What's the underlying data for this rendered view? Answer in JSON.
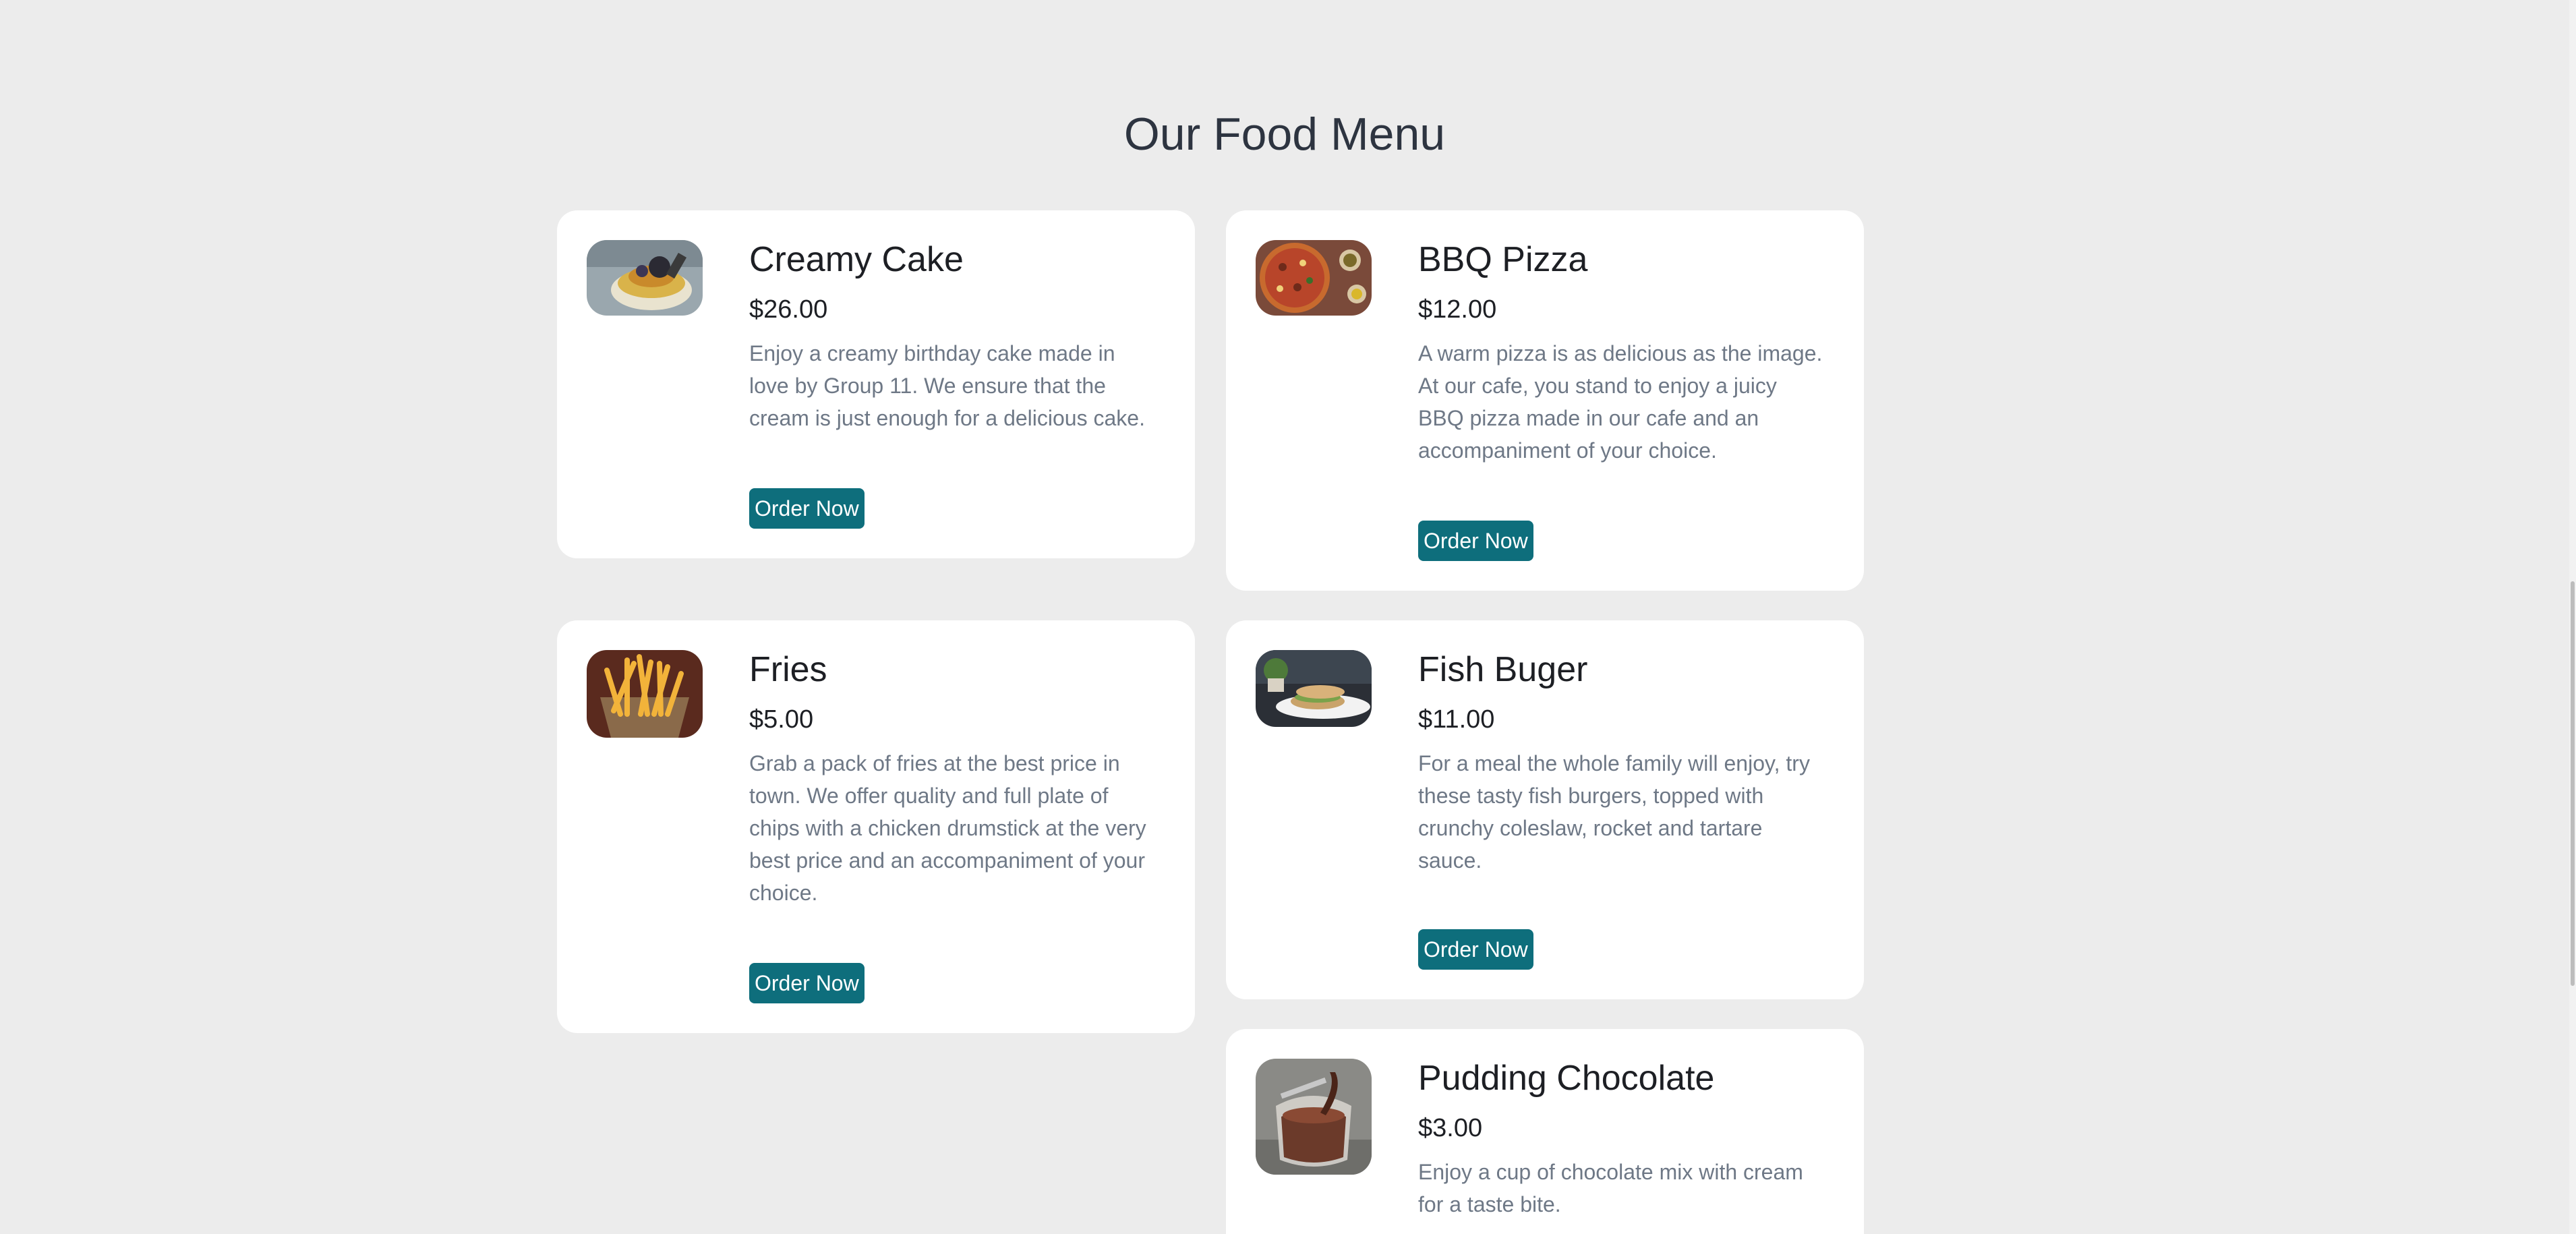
{
  "page": {
    "title": "Our Food Menu"
  },
  "menu": {
    "button_label": "Order Now",
    "items": [
      {
        "name": "Creamy Cake",
        "price": "$26.00",
        "description": "Enjoy a creamy birthday cake made in love by Group 11. We ensure that the cream is just enough for a delicious cake."
      },
      {
        "name": "BBQ Pizza",
        "price": "$12.00",
        "description": "A warm pizza is as delicious as the image. At our cafe, you stand to enjoy a juicy BBQ pizza made in our cafe and an accompaniment of your choice."
      },
      {
        "name": "Fries",
        "price": "$5.00",
        "description": "Grab a pack of fries at the best price in town. We offer quality and full plate of chips with a chicken drumstick at the very best price and an accompaniment of your choice."
      },
      {
        "name": "Fish Buger",
        "price": "$11.00",
        "description": "For a meal the whole family will enjoy, try these tasty fish burgers, topped with crunchy coleslaw, rocket and tartare sauce."
      },
      {
        "name": "Pudding Chocolate",
        "price": "$3.00",
        "description": "Enjoy a cup of chocolate mix with cream for a taste bite."
      }
    ]
  },
  "colors": {
    "background": "#ececec",
    "card": "#ffffff",
    "button": "#0e6e7c",
    "title": "#2d3440",
    "description": "#6e7886"
  },
  "scrollbar": {
    "position_fraction": 0.47
  }
}
